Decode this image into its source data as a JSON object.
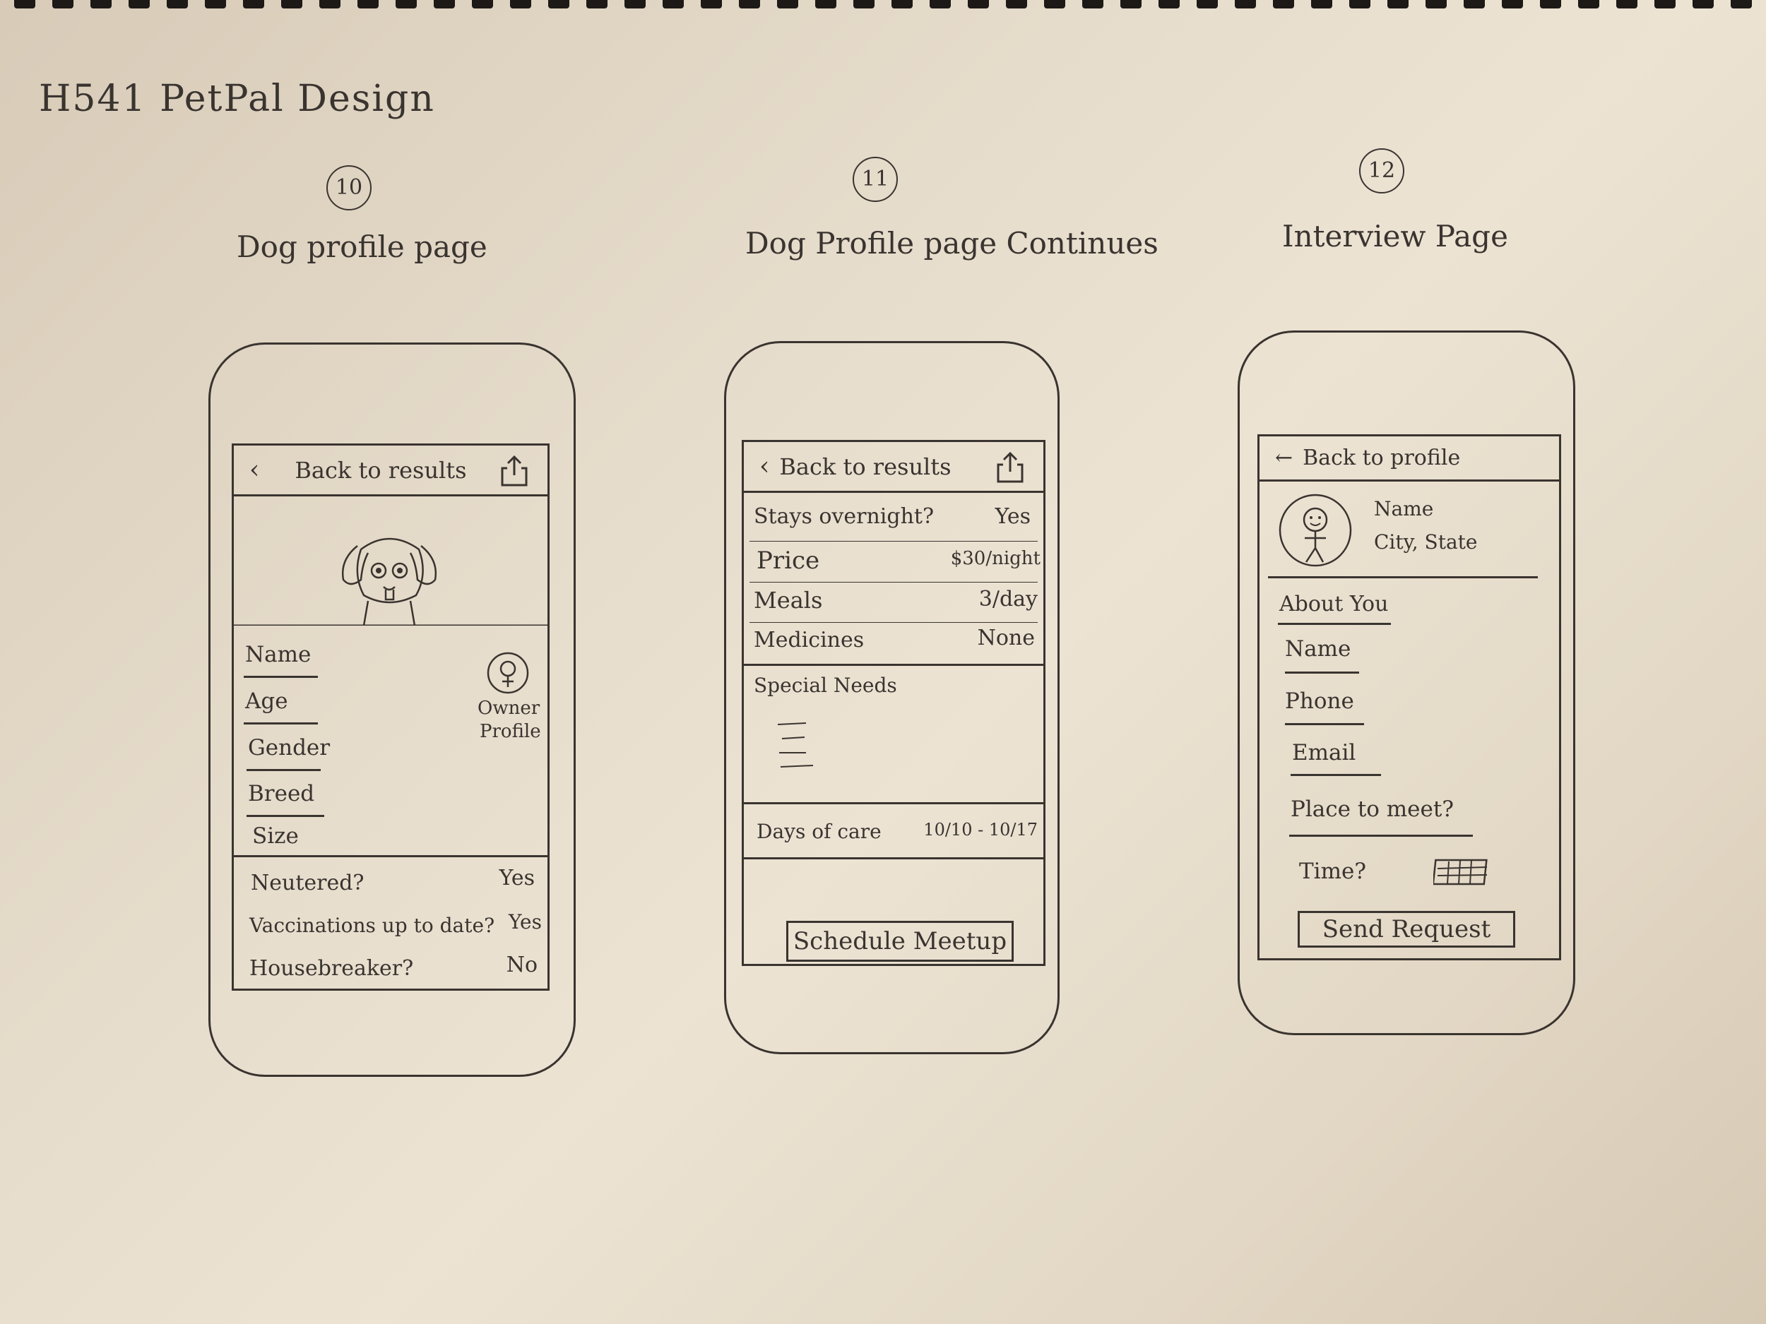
{
  "notebook_title": "H541 PetPal Design",
  "screens": [
    {
      "number": "10",
      "caption": "Dog profile page",
      "nav": {
        "back_label": "Back to results"
      },
      "fields": [
        "Name",
        "Age",
        "Gender",
        "Breed",
        "Size"
      ],
      "owner_label_1": "Owner",
      "owner_label_2": "Profile",
      "questions": [
        {
          "label": "Neutered?",
          "value": "Yes"
        },
        {
          "label": "Vaccinations up to date?",
          "value": "Yes"
        },
        {
          "label": "Housebreaker?",
          "value": "No"
        }
      ]
    },
    {
      "number": "11",
      "caption": "Dog Profile page Continues",
      "nav": {
        "back_label": "Back to results"
      },
      "details": [
        {
          "label": "Stays overnight?",
          "value": "Yes"
        },
        {
          "label": "Price",
          "value": "$30/night"
        },
        {
          "label": "Meals",
          "value": "3/day"
        },
        {
          "label": "Medicines",
          "value": "None"
        }
      ],
      "special_needs_label": "Special Needs",
      "days_label": "Days of care",
      "days_value": "10/10 - 10/17",
      "schedule_button": "Schedule Meetup"
    },
    {
      "number": "12",
      "caption": "Interview Page",
      "nav": {
        "back_label": "Back to profile"
      },
      "profile_name": "Name",
      "profile_location": "City, State",
      "about_label": "About You",
      "fields": [
        "Name",
        "Phone",
        "Email"
      ],
      "place_label": "Place to meet?",
      "time_label": "Time?",
      "send_button": "Send Request"
    }
  ]
}
